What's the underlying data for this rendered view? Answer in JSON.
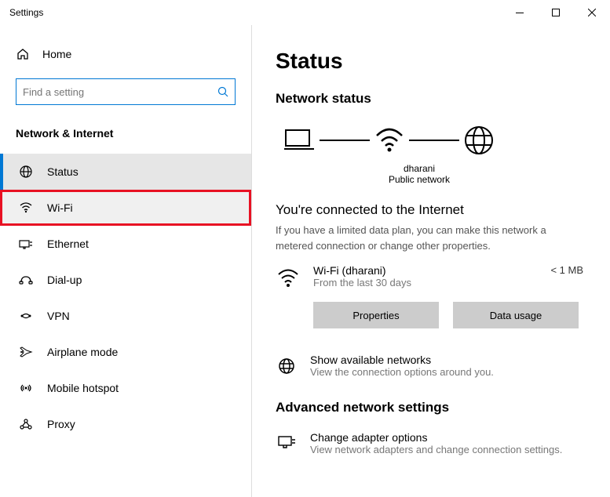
{
  "window": {
    "title": "Settings"
  },
  "sidebar": {
    "home": "Home",
    "search_placeholder": "Find a setting",
    "category": "Network & Internet",
    "items": [
      {
        "label": "Status"
      },
      {
        "label": "Wi-Fi"
      },
      {
        "label": "Ethernet"
      },
      {
        "label": "Dial-up"
      },
      {
        "label": "VPN"
      },
      {
        "label": "Airplane mode"
      },
      {
        "label": "Mobile hotspot"
      },
      {
        "label": "Proxy"
      }
    ]
  },
  "main": {
    "title": "Status",
    "network_status": "Network status",
    "diagram": {
      "name": "dharani",
      "type": "Public network"
    },
    "connected_title": "You're connected to the Internet",
    "connected_desc": "If you have a limited data plan, you can make this network a metered connection or change other properties.",
    "connection": {
      "name": "Wi-Fi (dharani)",
      "period": "From the last 30 days",
      "usage": "< 1 MB"
    },
    "buttons": {
      "properties": "Properties",
      "data_usage": "Data usage"
    },
    "show_networks": {
      "title": "Show available networks",
      "desc": "View the connection options around you."
    },
    "advanced_title": "Advanced network settings",
    "adapter": {
      "title": "Change adapter options",
      "desc": "View network adapters and change connection settings."
    }
  }
}
